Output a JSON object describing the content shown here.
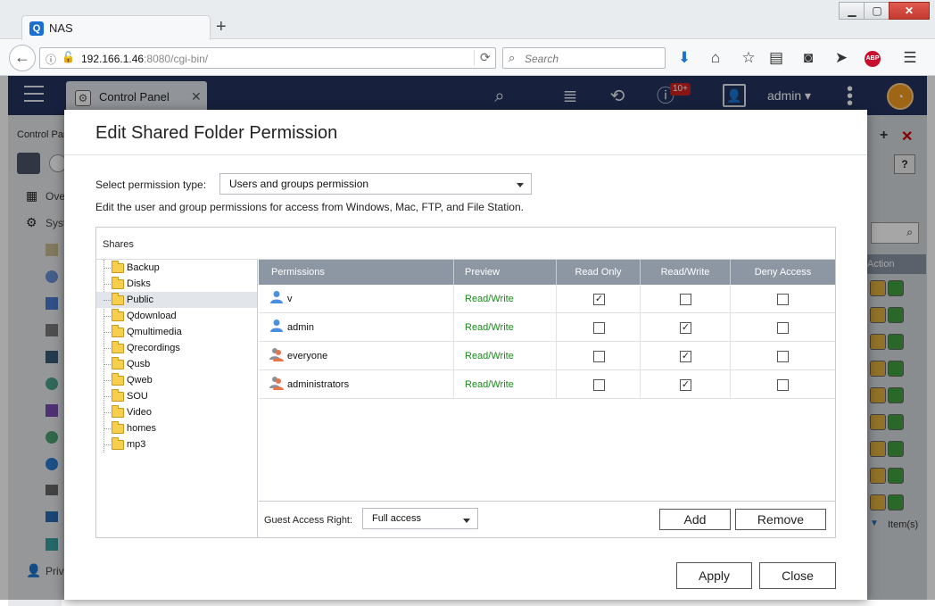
{
  "browser": {
    "tab_title": "NAS",
    "favicon_letter": "Q",
    "new_tab_symbol": "+",
    "url_host": "192.166.1.46",
    "url_path": ":8080/cgi-bin/",
    "search_placeholder": "Search",
    "abp_label": "ABP",
    "window_controls": [
      "▁",
      "▢",
      "✕"
    ]
  },
  "app_header": {
    "tab_title": "Control Panel",
    "notification_count": "10+",
    "user_label": "admin"
  },
  "background_panel": {
    "title": "Control Pan",
    "sidebar_items": [
      "Ove",
      "Syst",
      "Priv"
    ],
    "action_header": "Action",
    "items_label": "Item(s)"
  },
  "dialog": {
    "title": "Edit Shared Folder Permission",
    "permission_type_label": "Select permission type:",
    "permission_type_value": "Users and groups permission",
    "description": "Edit the user and group permissions for access from Windows, Mac, FTP, and File Station.",
    "shares_label": "Shares",
    "folders": [
      "Backup",
      "Disks",
      "Public",
      "Qdownload",
      "Qmultimedia",
      "Qrecordings",
      "Qusb",
      "Qweb",
      "SOU",
      "Video",
      "homes",
      "mp3"
    ],
    "selected_folder": "Public",
    "columns": [
      "Permissions",
      "Preview",
      "Read Only",
      "Read/Write",
      "Deny Access"
    ],
    "rows": [
      {
        "name": "v",
        "type": "user",
        "preview": "Read/Write",
        "read_only": true,
        "read_write": false,
        "deny": false
      },
      {
        "name": "admin",
        "type": "user",
        "preview": "Read/Write",
        "read_only": false,
        "read_write": true,
        "deny": false
      },
      {
        "name": "everyone",
        "type": "group",
        "preview": "Read/Write",
        "read_only": false,
        "read_write": true,
        "deny": false
      },
      {
        "name": "administrators",
        "type": "group",
        "preview": "Read/Write",
        "read_only": false,
        "read_write": true,
        "deny": false
      }
    ],
    "guest_access_label": "Guest Access Right:",
    "guest_access_value": "Full access",
    "add_label": "Add",
    "remove_label": "Remove",
    "apply_label": "Apply",
    "close_label": "Close"
  },
  "colors": {
    "app_header": "#24345e",
    "grid_header": "#8d96a3",
    "preview_green": "#1b8a1b",
    "badge_red": "#d11f1f",
    "gauge_orange": "#f29b1f"
  }
}
